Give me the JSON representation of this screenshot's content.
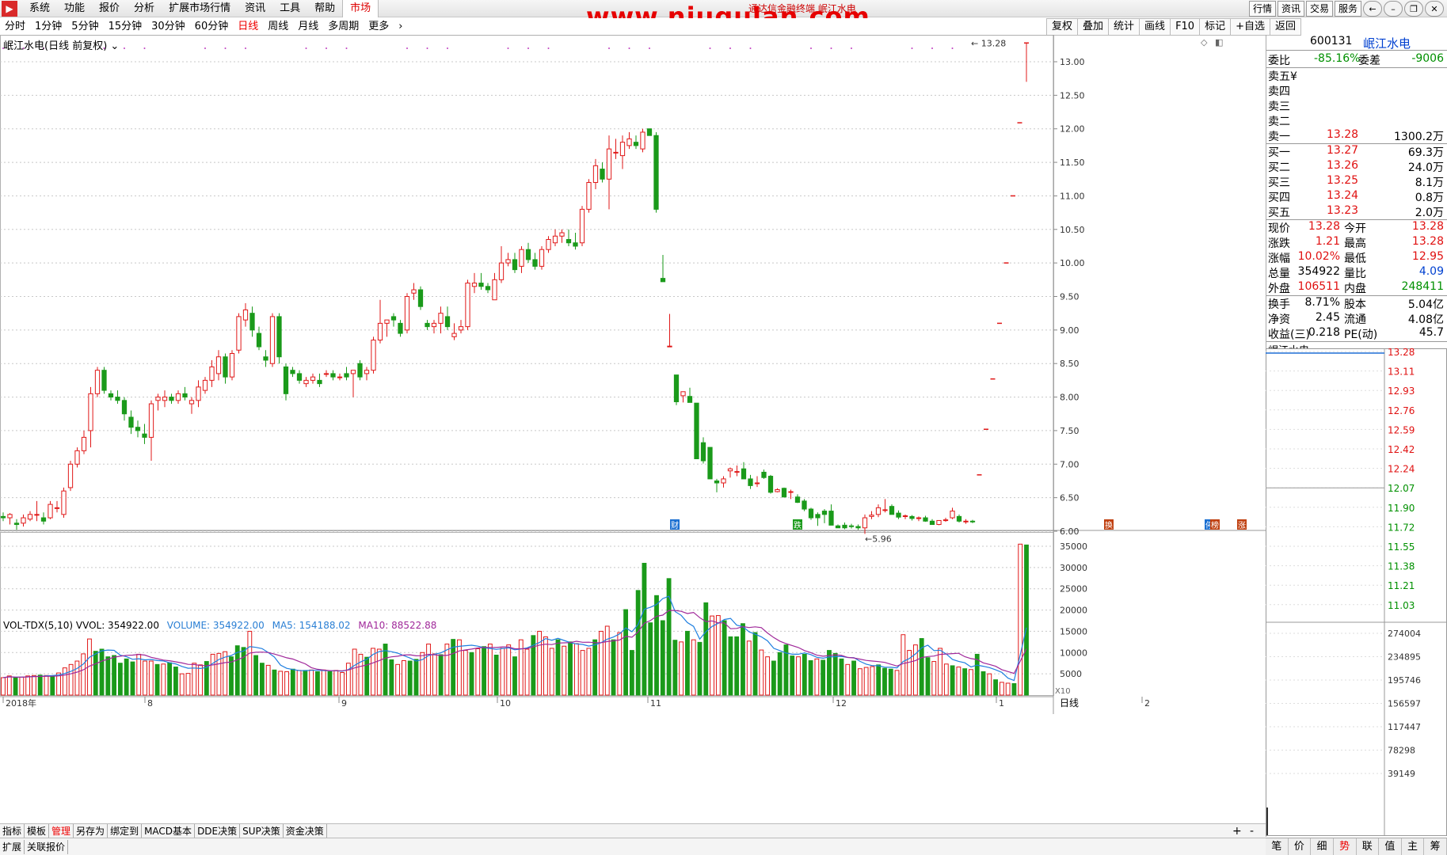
{
  "menu": {
    "items": [
      "系统",
      "功能",
      "报价",
      "分析",
      "扩展市场行情",
      "资讯",
      "工具",
      "帮助"
    ],
    "market": "市场",
    "window_title": "通达信金融终端 岷江水电",
    "watermark": "www.niugulan.com",
    "right_buttons": [
      "行情",
      "资讯",
      "交易",
      "服务"
    ]
  },
  "periods": {
    "items": [
      "分时",
      "1分钟",
      "5分钟",
      "15分钟",
      "30分钟",
      "60分钟",
      "日线",
      "周线",
      "月线",
      "多周期",
      "更多"
    ],
    "active": "日线"
  },
  "toolbar2": {
    "items": [
      "复权",
      "叠加",
      "统计",
      "画线",
      "F10",
      "标记",
      "+自选",
      "返回"
    ]
  },
  "chart": {
    "title": "岷江水电(日线 前复权)",
    "price_ticks": [
      "13.00",
      "12.50",
      "12.00",
      "11.50",
      "11.00",
      "10.50",
      "10.00",
      "9.50",
      "9.00",
      "8.50",
      "8.00",
      "7.50",
      "7.00",
      "6.50",
      "6.00"
    ],
    "high_label": "13.28",
    "low_label": "5.96",
    "date_labels": [
      "2018年",
      "8",
      "9",
      "10",
      "11",
      "12",
      "1",
      "2"
    ],
    "period_label": "日线",
    "volume_ticks": [
      "35000",
      "30000",
      "25000",
      "20000",
      "15000",
      "10000",
      "5000"
    ],
    "vol_unit": "X10",
    "event_marks": [
      "财",
      "跌",
      "换",
      "停",
      "榜",
      "涨"
    ],
    "candles": [
      [
        6.22,
        6.28,
        6.15,
        6.2
      ],
      [
        6.2,
        6.27,
        6.1,
        6.25
      ],
      [
        6.12,
        6.18,
        6.02,
        6.1
      ],
      [
        6.12,
        6.25,
        6.07,
        6.2
      ],
      [
        6.18,
        6.3,
        6.15,
        6.25
      ],
      [
        6.25,
        6.45,
        6.15,
        6.25
      ],
      [
        6.2,
        6.28,
        6.1,
        6.15
      ],
      [
        6.2,
        6.45,
        6.18,
        6.4
      ],
      [
        6.35,
        6.45,
        6.28,
        6.35
      ],
      [
        6.25,
        6.65,
        6.2,
        6.6
      ],
      [
        6.65,
        7.05,
        6.6,
        7.0
      ],
      [
        7.0,
        7.25,
        6.95,
        7.2
      ],
      [
        7.2,
        7.5,
        7.15,
        7.4
      ],
      [
        7.5,
        8.15,
        7.25,
        8.05
      ],
      [
        8.05,
        8.45,
        8.0,
        8.4
      ],
      [
        8.4,
        8.45,
        8.05,
        8.1
      ],
      [
        8.05,
        8.1,
        7.95,
        8.0
      ],
      [
        8.0,
        8.1,
        7.9,
        7.95
      ],
      [
        7.95,
        8.0,
        7.65,
        7.75
      ],
      [
        7.7,
        7.8,
        7.45,
        7.55
      ],
      [
        7.55,
        7.65,
        7.4,
        7.5
      ],
      [
        7.45,
        7.6,
        7.3,
        7.4
      ],
      [
        7.4,
        7.95,
        7.05,
        7.9
      ],
      [
        7.95,
        8.05,
        7.8,
        8.0
      ],
      [
        7.95,
        8.1,
        7.85,
        8.0
      ],
      [
        8.0,
        8.05,
        7.9,
        7.95
      ],
      [
        7.95,
        8.1,
        7.9,
        8.05
      ],
      [
        8.05,
        8.15,
        7.95,
        8.0
      ],
      [
        7.9,
        8.0,
        7.75,
        7.95
      ],
      [
        7.95,
        8.25,
        7.85,
        8.15
      ],
      [
        8.1,
        8.3,
        8.05,
        8.25
      ],
      [
        8.25,
        8.55,
        8.15,
        8.45
      ],
      [
        8.35,
        8.7,
        8.25,
        8.6
      ],
      [
        8.6,
        8.65,
        8.2,
        8.3
      ],
      [
        8.3,
        8.7,
        8.25,
        8.65
      ],
      [
        8.7,
        9.25,
        8.65,
        9.2
      ],
      [
        9.15,
        9.4,
        9.05,
        9.3
      ],
      [
        9.25,
        9.35,
        8.9,
        9.0
      ],
      [
        8.95,
        9.05,
        8.7,
        8.75
      ],
      [
        8.6,
        8.7,
        8.45,
        8.55
      ],
      [
        8.5,
        9.25,
        8.45,
        9.2
      ],
      [
        9.2,
        9.25,
        8.5,
        8.6
      ],
      [
        8.45,
        8.5,
        7.95,
        8.05
      ],
      [
        8.4,
        8.45,
        8.3,
        8.35
      ],
      [
        8.35,
        8.4,
        8.2,
        8.25
      ],
      [
        8.2,
        8.3,
        8.15,
        8.25
      ],
      [
        8.25,
        8.35,
        8.2,
        8.3
      ],
      [
        8.25,
        8.35,
        8.15,
        8.2
      ],
      [
        8.35,
        8.4,
        8.3,
        8.35
      ],
      [
        8.35,
        8.4,
        8.25,
        8.3
      ],
      [
        8.3,
        8.35,
        8.25,
        8.3
      ],
      [
        8.35,
        8.45,
        8.25,
        8.3
      ],
      [
        8.35,
        8.4,
        8.0,
        8.4
      ],
      [
        8.5,
        8.55,
        8.25,
        8.3
      ],
      [
        8.35,
        8.45,
        8.25,
        8.4
      ],
      [
        8.4,
        8.9,
        8.35,
        8.85
      ],
      [
        8.85,
        9.45,
        8.8,
        9.1
      ],
      [
        9.1,
        9.15,
        8.9,
        9.15
      ],
      [
        9.2,
        9.25,
        9.05,
        9.15
      ],
      [
        9.1,
        9.15,
        8.9,
        8.95
      ],
      [
        9.0,
        9.55,
        8.95,
        9.5
      ],
      [
        9.55,
        9.7,
        9.45,
        9.6
      ],
      [
        9.6,
        9.65,
        9.3,
        9.35
      ],
      [
        9.1,
        9.15,
        9.0,
        9.05
      ],
      [
        9.05,
        9.15,
        8.95,
        9.1
      ],
      [
        9.1,
        9.35,
        8.95,
        9.25
      ],
      [
        9.2,
        9.35,
        9.0,
        9.05
      ],
      [
        8.9,
        9.1,
        8.85,
        8.95
      ],
      [
        9.0,
        9.15,
        8.95,
        9.05
      ],
      [
        9.05,
        9.75,
        9.0,
        9.7
      ],
      [
        9.65,
        9.85,
        9.55,
        9.7
      ],
      [
        9.7,
        9.85,
        9.6,
        9.65
      ],
      [
        9.65,
        9.7,
        9.55,
        9.6
      ],
      [
        9.45,
        9.85,
        9.45,
        9.75
      ],
      [
        9.75,
        10.25,
        9.7,
        10.0
      ],
      [
        10.0,
        10.15,
        9.95,
        10.05
      ],
      [
        10.05,
        10.15,
        9.85,
        9.9
      ],
      [
        9.95,
        10.25,
        9.85,
        10.2
      ],
      [
        10.2,
        10.3,
        10.0,
        10.05
      ],
      [
        10.05,
        10.15,
        9.9,
        9.95
      ],
      [
        9.95,
        10.25,
        9.9,
        10.2
      ],
      [
        10.2,
        10.4,
        10.15,
        10.35
      ],
      [
        10.3,
        10.5,
        10.25,
        10.4
      ],
      [
        10.4,
        10.5,
        10.3,
        10.45
      ],
      [
        10.35,
        10.5,
        10.25,
        10.3
      ],
      [
        10.3,
        10.45,
        10.2,
        10.25
      ],
      [
        10.3,
        10.85,
        10.25,
        10.8
      ],
      [
        10.8,
        11.25,
        10.75,
        11.2
      ],
      [
        11.2,
        11.55,
        11.1,
        11.45
      ],
      [
        11.4,
        11.5,
        11.2,
        11.25
      ],
      [
        11.25,
        11.9,
        10.8,
        11.7
      ],
      [
        11.65,
        11.85,
        11.55,
        11.65
      ],
      [
        11.6,
        11.9,
        11.4,
        11.8
      ],
      [
        11.75,
        11.95,
        11.7,
        11.85
      ],
      [
        11.8,
        11.9,
        11.7,
        11.75
      ],
      [
        11.7,
        12.0,
        11.65,
        11.95
      ],
      [
        12.0,
        12.0,
        11.9,
        11.9
      ],
      [
        11.9,
        11.95,
        10.75,
        10.8
      ]
    ],
    "drop_candles": [
      [
        9.77,
        10.12,
        9.72,
        9.72
      ],
      [
        8.76,
        9.24,
        8.76,
        8.76
      ],
      [
        8.33,
        8.33,
        7.88,
        7.93
      ],
      [
        8.02,
        8.02,
        7.92,
        8.08
      ],
      [
        8.01,
        8.14,
        7.92,
        7.92
      ],
      [
        7.91,
        7.91,
        7.08,
        7.08
      ],
      [
        7.32,
        7.4,
        7.01,
        7.05
      ],
      [
        7.25,
        7.25,
        6.78,
        6.78
      ],
      [
        6.75,
        6.78,
        6.58,
        6.72
      ],
      [
        6.72,
        6.82,
        6.65,
        6.78
      ],
      [
        6.9,
        6.95,
        6.8,
        6.93
      ],
      [
        6.88,
        6.98,
        6.82,
        6.89
      ],
      [
        6.93,
        7.03,
        6.79,
        6.78
      ],
      [
        6.78,
        6.84,
        6.63,
        6.68
      ],
      [
        6.72,
        6.82,
        6.66,
        6.72
      ],
      [
        6.88,
        6.92,
        6.78,
        6.8
      ],
      [
        6.82,
        6.84,
        6.56,
        6.58
      ],
      [
        6.59,
        6.64,
        6.58,
        6.62
      ],
      [
        6.64,
        6.65,
        6.51,
        6.51
      ],
      [
        6.58,
        6.62,
        6.48,
        6.59
      ],
      [
        6.51,
        6.55,
        6.42,
        6.43
      ],
      [
        6.45,
        6.48,
        6.3,
        6.33
      ],
      [
        6.33,
        6.35,
        6.17,
        6.2
      ],
      [
        6.25,
        6.28,
        6.08,
        6.2
      ],
      [
        6.3,
        6.33,
        6.12,
        6.25
      ],
      [
        6.3,
        6.4,
        6.2,
        6.09
      ],
      [
        6.08,
        6.1,
        6.05,
        6.05
      ],
      [
        6.09,
        6.13,
        6.03,
        6.05
      ],
      [
        6.08,
        6.11,
        6.04,
        6.07
      ],
      [
        6.07,
        6.1,
        6.02,
        6.05
      ],
      [
        6.05,
        6.25,
        5.96,
        6.2
      ],
      [
        6.22,
        6.3,
        6.18,
        6.24
      ],
      [
        6.25,
        6.4,
        6.21,
        6.35
      ],
      [
        6.32,
        6.48,
        6.28,
        6.32
      ],
      [
        6.37,
        6.4,
        6.25,
        6.25
      ],
      [
        6.27,
        6.31,
        6.18,
        6.21
      ],
      [
        6.22,
        6.25,
        6.18,
        6.23
      ],
      [
        6.22,
        6.24,
        6.16,
        6.19
      ],
      [
        6.19,
        6.22,
        6.15,
        6.2
      ],
      [
        6.2,
        6.23,
        6.14,
        6.15
      ],
      [
        6.15,
        6.18,
        6.1,
        6.1
      ],
      [
        6.1,
        6.16,
        6.09,
        6.16
      ],
      [
        6.17,
        6.2,
        6.14,
        6.17
      ],
      [
        6.2,
        6.35,
        6.18,
        6.3
      ],
      [
        6.22,
        6.25,
        6.13,
        6.15
      ],
      [
        6.14,
        6.18,
        6.11,
        6.15
      ],
      [
        6.15,
        6.17,
        6.12,
        6.14
      ]
    ],
    "ladder": [
      [
        6.82,
        6.84
      ],
      [
        7.5,
        7.52
      ],
      [
        8.25,
        8.27
      ],
      [
        9.08,
        9.1
      ],
      [
        9.98,
        10.0
      ],
      [
        10.98,
        11.0
      ],
      [
        12.07,
        12.09
      ],
      [
        13.0,
        13.28
      ]
    ],
    "volumes": [
      4100,
      4500,
      4100,
      4200,
      4500,
      4600,
      4700,
      4600,
      4500,
      5200,
      6400,
      7200,
      8000,
      9700,
      13200,
      10300,
      10800,
      9000,
      9300,
      7500,
      8500,
      7800,
      9600,
      8000,
      8000,
      7200,
      7300,
      7600,
      6600,
      5000,
      5100,
      7500,
      7100,
      7900,
      9600,
      9800,
      10200,
      9000,
      11600,
      11200,
      15000,
      9300,
      7500,
      7000,
      5900,
      5600,
      5500,
      6100,
      5800,
      5800,
      5900,
      5500,
      5900,
      5500,
      5800,
      5300,
      7500,
      10800,
      9600,
      8900,
      11000,
      10800,
      12000,
      8300,
      7200,
      8100,
      8000,
      8400,
      10000,
      12000,
      9700,
      9500,
      12000,
      13100,
      13000,
      10500,
      10000,
      10900,
      11400,
      12000,
      9400,
      11000,
      11800,
      9000,
      13000,
      10800,
      14000,
      15000,
      13700,
      11000,
      13000,
      11500,
      12500,
      12100,
      10500,
      11000,
      13000,
      15000,
      16200,
      13000,
      14700,
      20100,
      10500,
      24600,
      31000,
      17000,
      23400,
      17500,
      27400,
      12900,
      12500,
      15000,
      13000,
      12400,
      21700,
      18600,
      18700,
      17500,
      13700,
      13700,
      16800,
      12700,
      14700,
      10600,
      9000,
      8000,
      10000,
      11800,
      9200,
      9000,
      9600,
      8100,
      8500,
      8200,
      10500,
      9800,
      8500,
      7200,
      8000,
      6200,
      6500,
      6700,
      7100,
      6300,
      6100,
      5800,
      14200,
      10500,
      11800,
      13300,
      8800,
      7900,
      11000,
      7300,
      6900,
      6600,
      6200,
      6000,
      9600,
      5500,
      5000,
      3600,
      3000,
      2800,
      2700,
      35500,
      35300
    ],
    "vol_up": [
      1,
      1,
      0,
      1,
      1,
      1,
      0,
      1,
      0,
      1,
      1,
      1,
      1,
      1,
      1,
      0,
      0,
      0,
      0,
      0,
      0,
      0,
      1,
      1,
      1,
      0,
      1,
      0,
      0,
      1,
      1,
      1,
      1,
      0,
      1,
      1,
      1,
      0,
      0,
      0,
      1,
      0,
      0,
      1,
      0,
      1,
      1,
      0,
      1,
      0,
      1,
      0,
      1,
      0,
      1,
      1,
      1,
      1,
      1,
      0,
      1,
      1,
      0,
      0,
      1,
      1,
      0,
      0,
      1,
      1,
      1,
      0,
      1,
      0,
      1,
      1,
      0,
      1,
      0,
      1,
      0,
      1,
      1,
      0,
      1,
      1,
      0,
      1,
      1,
      1,
      0,
      1,
      0,
      1,
      1,
      1,
      0,
      1,
      1,
      0,
      1,
      0,
      0,
      0,
      0,
      0,
      0,
      0,
      0,
      0,
      1,
      0,
      1,
      0,
      0,
      1,
      1,
      0,
      0,
      0,
      0,
      1,
      0,
      1,
      1,
      0,
      0,
      0,
      0,
      1,
      0,
      0,
      1,
      0,
      0,
      0,
      0,
      1,
      0,
      1,
      1,
      1,
      0,
      0,
      0,
      1,
      1,
      1,
      1,
      0,
      0,
      1,
      1,
      1,
      0,
      1,
      0,
      1,
      0,
      0,
      1,
      0,
      1,
      1,
      0,
      1,
      0,
      1,
      1
    ]
  },
  "vol_legend": {
    "name": "VOL-TDX(5,10)",
    "vvol": "VVOL: 354922.00",
    "volume": "VOLUME: 354922.00",
    "ma5": "MA5: 154188.02",
    "ma10": "MA10: 88522.88"
  },
  "quote": {
    "code": "600131",
    "name": "岷江水电",
    "weibi_label": "委比",
    "weibi": "-85.16%",
    "weicha_label": "委差",
    "weicha": "-9006",
    "sells": [
      {
        "label": "卖五",
        "price": "",
        "vol": "",
        "flag": "¥"
      },
      {
        "label": "卖四",
        "price": "",
        "vol": ""
      },
      {
        "label": "卖三",
        "price": "",
        "vol": ""
      },
      {
        "label": "卖二",
        "price": "",
        "vol": ""
      },
      {
        "label": "卖一",
        "price": "13.28",
        "vol": "1300.2万"
      }
    ],
    "buys": [
      {
        "label": "买一",
        "price": "13.27",
        "vol": "69.3万"
      },
      {
        "label": "买二",
        "price": "13.26",
        "vol": "24.0万"
      },
      {
        "label": "买三",
        "price": "13.25",
        "vol": "8.1万"
      },
      {
        "label": "买四",
        "price": "13.24",
        "vol": "0.8万"
      },
      {
        "label": "买五",
        "price": "13.23",
        "vol": "2.0万"
      }
    ],
    "stats": [
      [
        "现价",
        "13.28",
        "今开",
        "13.28"
      ],
      [
        "涨跌",
        "1.21",
        "最高",
        "13.28"
      ],
      [
        "涨幅",
        "10.02%",
        "最低",
        "12.95"
      ],
      [
        "总量",
        "354922",
        "量比",
        "4.09"
      ],
      [
        "外盘",
        "106511",
        "内盘",
        "248411"
      ],
      [
        "换手",
        "8.71%",
        "股本",
        "5.04亿"
      ],
      [
        "净资",
        "2.45",
        "流通",
        "4.08亿"
      ],
      [
        "收益(三)",
        "0.218",
        "PE(动)",
        "45.7"
      ]
    ],
    "mini_name": "岷江水电",
    "mini_prices": [
      "13.28",
      "13.11",
      "12.93",
      "12.76",
      "12.59",
      "12.42",
      "12.24",
      "12.07",
      "11.90",
      "11.72",
      "11.55",
      "11.38",
      "11.21",
      "11.03"
    ],
    "mini_vols": [
      "274004",
      "234895",
      "195746",
      "156597",
      "117447",
      "78298",
      "39149"
    ]
  },
  "bottom_tabs": [
    "指标",
    "模板",
    "管理",
    "另存为",
    "绑定到",
    "MACD基本",
    "DDE决策",
    "SUP决策",
    "资金决策"
  ],
  "bottom_active": "管理",
  "bottom2": [
    "扩展",
    "关联报价"
  ],
  "right_tabs": [
    "笔",
    "价",
    "细",
    "势",
    "联",
    "值",
    "主",
    "筹"
  ],
  "right_active": "势",
  "colors": {
    "up": "#e01818",
    "down": "#1a9a1a",
    "ma5": "#1f7fe0",
    "ma10": "#a0289a",
    "grid": "#c8c8c8"
  }
}
